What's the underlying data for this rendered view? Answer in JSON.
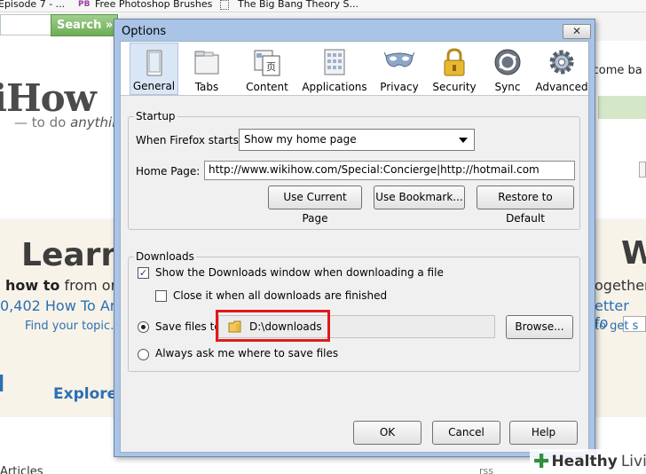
{
  "browser": {
    "bookmarks": [
      {
        "label": "Episode 7 - ..."
      },
      {
        "label": "Free Photoshop Brushes",
        "icon_text": "PB"
      },
      {
        "label": "The Big Bang Theory S..."
      }
    ],
    "search_button": "Search »",
    "logo": "iHow",
    "tagline_prefix": "— to do ",
    "tagline_emph": "anything",
    "welcome": "lcome ba",
    "hero": {
      "learn": "Learn",
      "howto_bold": "how to",
      "howto_rest": " from or",
      "count": "0,402 How To Ar",
      "find_topic": "Find your topic.",
      "explore": "Explore",
      "right_w": "W",
      "right_1": "ogether",
      "right_2": "etter fo",
      "right_3": "to get s"
    },
    "articles": "Articles",
    "rss": "rss"
  },
  "dialog": {
    "title": "Options",
    "close_label": "✕",
    "tabs": [
      {
        "label": "General",
        "icon": "general-icon"
      },
      {
        "label": "Tabs",
        "icon": "tabs-icon"
      },
      {
        "label": "Content",
        "icon": "content-icon"
      },
      {
        "label": "Applications",
        "icon": "applications-icon"
      },
      {
        "label": "Privacy",
        "icon": "privacy-mask-icon"
      },
      {
        "label": "Security",
        "icon": "security-lock-icon"
      },
      {
        "label": "Sync",
        "icon": "sync-icon"
      },
      {
        "label": "Advanced",
        "icon": "advanced-gear-icon"
      }
    ],
    "selected_tab": "General",
    "startup": {
      "title": "Startup",
      "when_starts_label": "When Firefox starts:",
      "when_starts_value": "Show my home page",
      "home_page_label": "Home Page:",
      "home_page_value": "http://www.wikihow.com/Special:Concierge|http://hotmail.com",
      "use_current_page": "Use Current Page",
      "use_bookmark": "Use Bookmark...",
      "restore_default": "Restore to Default"
    },
    "downloads": {
      "title": "Downloads",
      "show_window_label": "Show the Downloads window when downloading a file",
      "show_window_checked": true,
      "close_when_done_label": "Close it when all downloads are finished",
      "close_when_done_checked": false,
      "save_files_label": "Save files to",
      "save_path": "D:\\downloads",
      "browse": "Browse...",
      "always_ask_label": "Always ask me where to save files",
      "selected_option": "save"
    },
    "buttons": {
      "ok": "OK",
      "cancel": "Cancel",
      "help": "Help"
    }
  },
  "watermark": {
    "plus": "✚",
    "healthy": "Healthy",
    "living": "Living"
  },
  "colors": {
    "dialog_frame": "#a9c4e6",
    "highlight": "#e11919",
    "search_button": "#7ab862",
    "link_blue": "#2c6fb3"
  }
}
